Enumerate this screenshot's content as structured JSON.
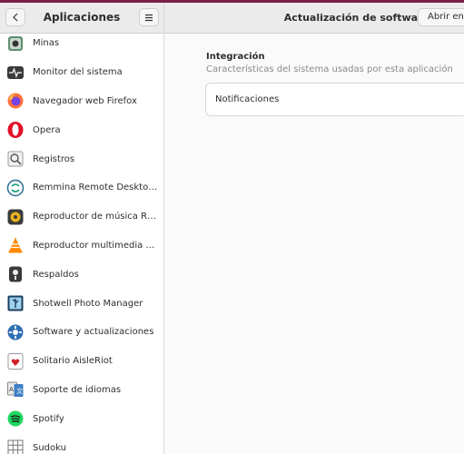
{
  "window": {
    "accent": "#7a1f4a"
  },
  "sidebar": {
    "title": "Aplicaciones",
    "back_icon": "chevron-left-icon",
    "menu_icon": "hamburger-menu-icon",
    "items": [
      {
        "label": "Minas",
        "icon": "mines-icon"
      },
      {
        "label": "Monitor del sistema",
        "icon": "system-monitor-icon"
      },
      {
        "label": "Navegador web Firefox",
        "icon": "firefox-icon"
      },
      {
        "label": "Opera",
        "icon": "opera-icon"
      },
      {
        "label": "Registros",
        "icon": "logs-icon"
      },
      {
        "label": "Remmina Remote Desktop Cl…",
        "icon": "remmina-icon"
      },
      {
        "label": "Reproductor de música Rhyt…",
        "icon": "rhythmbox-icon"
      },
      {
        "label": "Reproductor multimedia VLC",
        "icon": "vlc-icon"
      },
      {
        "label": "Respaldos",
        "icon": "backups-icon"
      },
      {
        "label": "Shotwell Photo Manager",
        "icon": "shotwell-icon"
      },
      {
        "label": "Software y actualizaciones",
        "icon": "software-updates-icon"
      },
      {
        "label": "Solitario AisleRiot",
        "icon": "solitaire-icon"
      },
      {
        "label": "Soporte de idiomas",
        "icon": "language-support-icon"
      },
      {
        "label": "Spotify",
        "icon": "spotify-icon"
      },
      {
        "label": "Sudoku",
        "icon": "sudoku-icon"
      }
    ]
  },
  "header": {
    "title": "Actualización de software",
    "open_button": "Abrir en S"
  },
  "main": {
    "section_title": "Integración",
    "section_subtitle": "Características del sistema usadas por esta aplicación",
    "rows": [
      {
        "label": "Notificaciones"
      }
    ]
  }
}
